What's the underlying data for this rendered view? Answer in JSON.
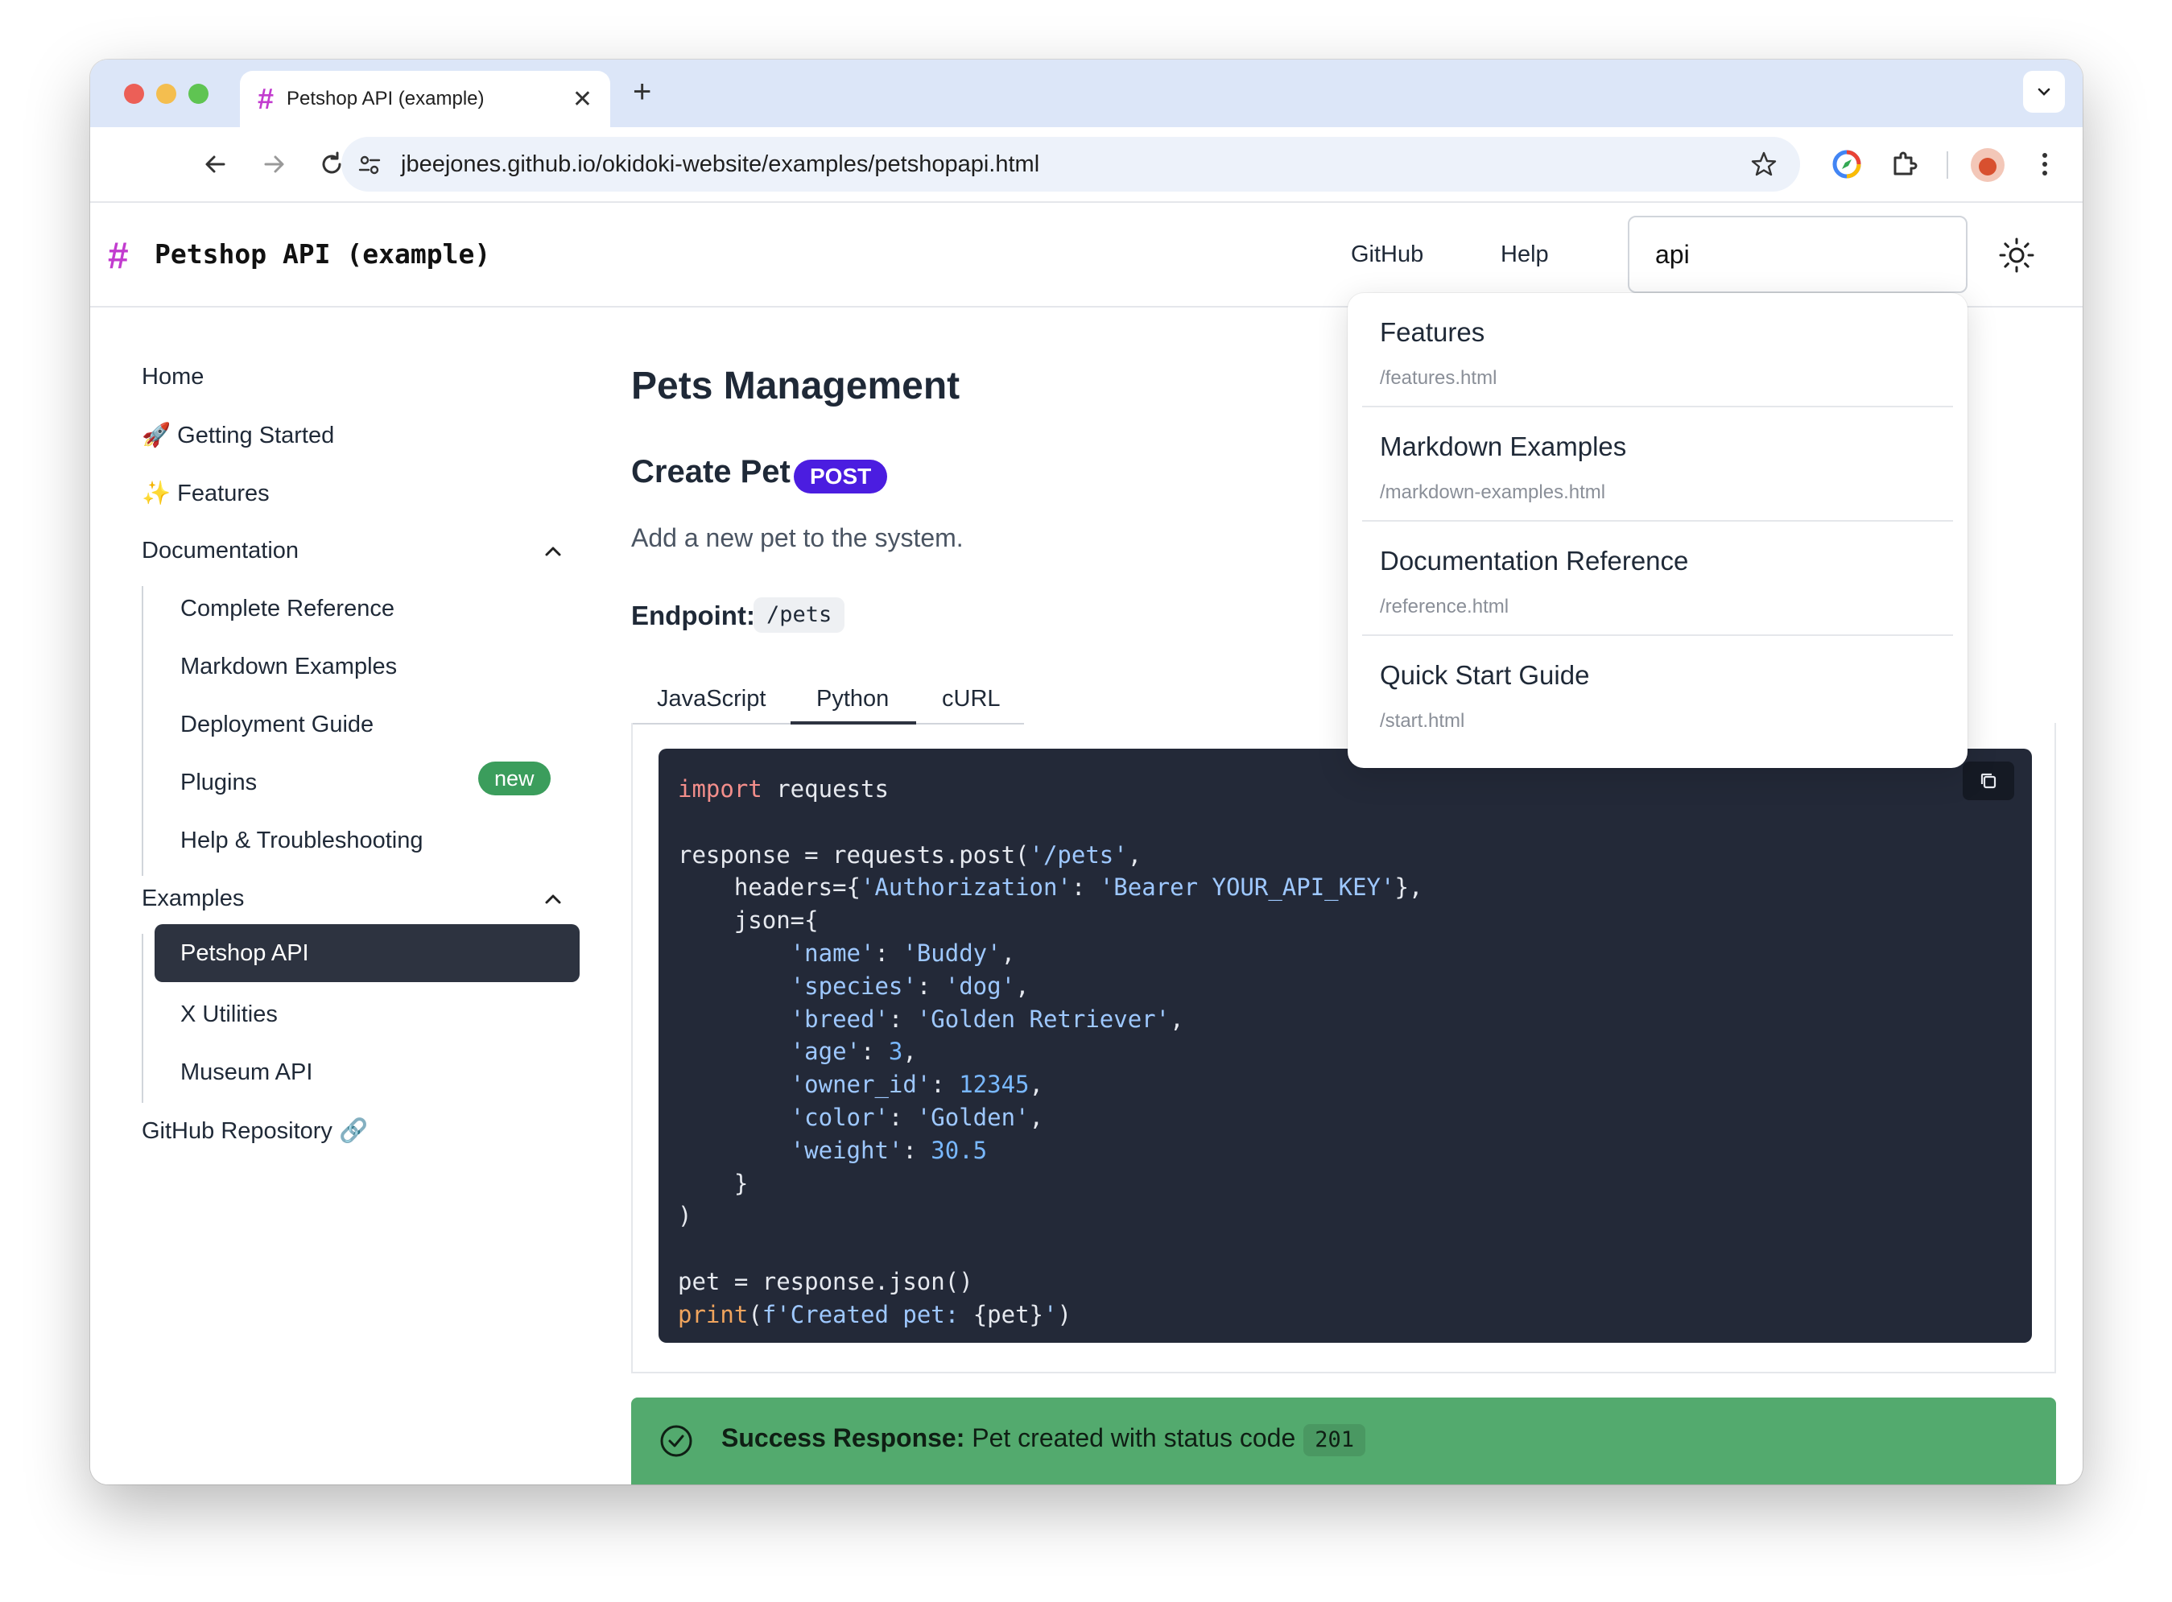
{
  "browser": {
    "tab_title": "Petshop API (example)",
    "url": "jbeejones.github.io/okidoki-website/examples/petshopapi.html"
  },
  "header": {
    "title": "Petshop API (example)",
    "links": [
      "GitHub",
      "Help"
    ],
    "search_value": "api"
  },
  "sidebar": {
    "home": "Home",
    "getting_started": "🚀 Getting Started",
    "features": "✨ Features",
    "documentation": "Documentation",
    "doc_items": [
      "Complete Reference",
      "Markdown Examples",
      "Deployment Guide",
      "Plugins",
      "Help & Troubleshooting"
    ],
    "plugins_badge": "new",
    "examples": "Examples",
    "example_items": [
      "Petshop API",
      "X Utilities",
      "Museum API"
    ],
    "github_repo": "GitHub Repository 🔗"
  },
  "main": {
    "heading": "Pets Management",
    "subheading": "Create Pet",
    "method_badge": "POST",
    "description": "Add a new pet to the system.",
    "endpoint_label": "Endpoint:",
    "endpoint": "/pets",
    "tabs": [
      "JavaScript",
      "Python",
      "cURL"
    ],
    "active_tab": "Python",
    "code": {
      "l1a": "import",
      "l1b": " requests",
      "l3a": "response = requests.post(",
      "l3b": "'/pets'",
      "l3c": ",",
      "l4a": "    headers={",
      "l4b": "'Authorization'",
      "l4c": ": ",
      "l4d": "'Bearer YOUR_API_KEY'",
      "l4e": "},",
      "l5": "    json={",
      "l6a": "        ",
      "l6b": "'name'",
      "l6c": ": ",
      "l6d": "'Buddy'",
      "l6e": ",",
      "l7b": "'species'",
      "l7d": "'dog'",
      "l8b": "'breed'",
      "l8d": "'Golden Retriever'",
      "l9b": "'age'",
      "l9d": "3",
      "l10b": "'owner_id'",
      "l10d": "12345",
      "l11b": "'color'",
      "l11d": "'Golden'",
      "l12b": "'weight'",
      "l12d": "30.5",
      "l13": "    }",
      "l14": ")",
      "l16": "pet = response.json()",
      "l17a": "print",
      "l17b": "(",
      "l17c": "f'Created pet: ",
      "l17d": "{pet}",
      "l17e": "'",
      "l17f": ")"
    },
    "success_label": "Success Response:",
    "success_text": " Pet created with status code",
    "success_code": "201"
  },
  "search_results": [
    {
      "title": "Features",
      "path": "/features.html"
    },
    {
      "title": "Markdown Examples",
      "path": "/markdown-examples.html"
    },
    {
      "title": "Documentation Reference",
      "path": "/reference.html"
    },
    {
      "title": "Quick Start Guide",
      "path": "/start.html"
    }
  ],
  "colors": {
    "accent_hash": "#c23ccf",
    "post_badge": "#4b1de0",
    "new_badge": "#3b9d5c",
    "success_bg": "#53aa6e",
    "code_bg": "#232938"
  }
}
